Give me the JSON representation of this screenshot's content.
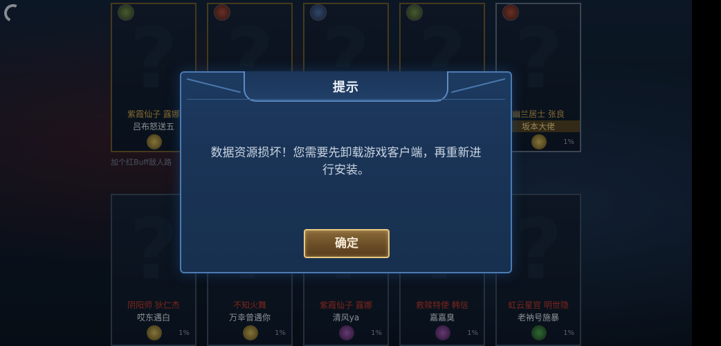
{
  "dialog": {
    "title": "提示",
    "message": "数据资源损坏！您需要先卸载游戏客户端，再重新进行安装。",
    "confirm_label": "确定"
  },
  "background": {
    "hint_text": "加个红Buff敌人路",
    "top_cards": [
      {
        "title": "紫霞仙子 露娜",
        "player": "吕布怒送五",
        "pct": ""
      },
      {
        "title": "",
        "player": "",
        "pct": ""
      },
      {
        "title": "",
        "player": "",
        "pct": ""
      },
      {
        "title": "",
        "player": "",
        "pct": ""
      },
      {
        "title": "幽兰居士 张良",
        "player": "坂本大佬",
        "pct": "1%"
      }
    ],
    "bottom_cards": [
      {
        "title": "阴阳师 狄仁杰",
        "player": "哎东遇白",
        "pct": "1%"
      },
      {
        "title": "不知火舞",
        "player": "万幸曾遇你",
        "pct": "1%"
      },
      {
        "title": "紫霞仙子 露娜",
        "player": "清风ya",
        "pct": "1%"
      },
      {
        "title": "救赎特使 韩信",
        "player": "嘉嘉臭",
        "pct": "1%"
      },
      {
        "title": "虹云星官 明世隐",
        "player": "老衲号施暴",
        "pct": "1%"
      }
    ]
  },
  "colors": {
    "dialog_border": "#4b7bb3",
    "button_border": "#e7c980",
    "red_title": "#c0392b",
    "gold_title": "#c8a24a"
  }
}
